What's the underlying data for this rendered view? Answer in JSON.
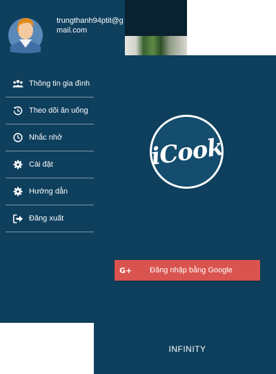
{
  "drawer": {
    "email": "trungthanh94ptit@gmail.com",
    "avatar_icon": "user-avatar-icon",
    "items": [
      {
        "label": "Thông tin gia đình",
        "icon": "family-icon"
      },
      {
        "label": "Theo dõi ăn uống",
        "icon": "history-icon"
      },
      {
        "label": "Nhắc nhở",
        "icon": "clock-icon"
      },
      {
        "label": "Cài đặt",
        "icon": "gear-icon"
      },
      {
        "label": "Hướng dẫn",
        "icon": "gear-icon"
      },
      {
        "label": "Đăng xuất",
        "icon": "logout-icon"
      }
    ]
  },
  "login": {
    "logo_text": "iCook",
    "google_button_label": "Đăng nhập bằng Google",
    "google_icon_text": "G+",
    "footer_brand": "INFINITY"
  },
  "colors": {
    "background": "#0e3f5d",
    "google_button": "#d9534f",
    "text": "#ffffff",
    "divider": "#7f97a6"
  }
}
